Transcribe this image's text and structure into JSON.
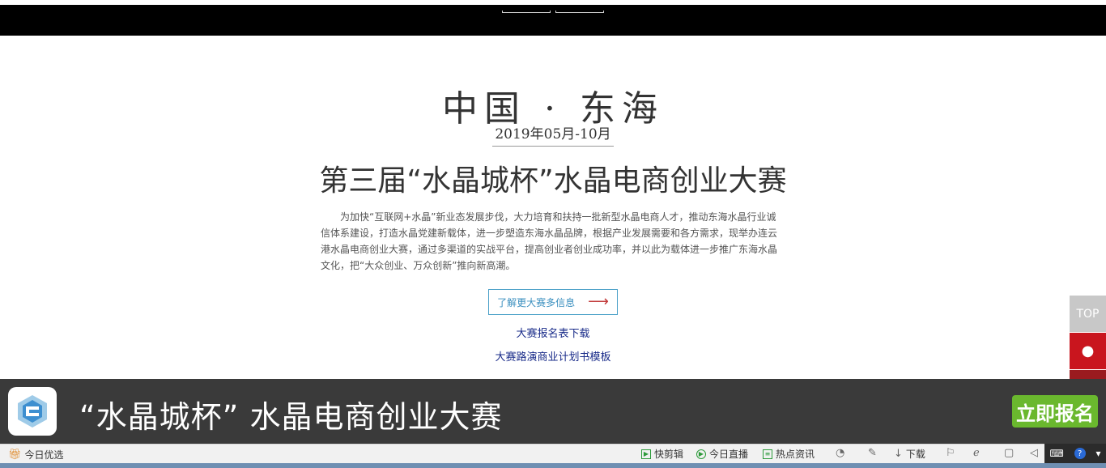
{
  "hero": {
    "headline": "中国 · 东海",
    "date": "2019年05月-10月",
    "title": "第三届“水晶城杯”水晶电商创业大赛",
    "intro": "为加快“互联网+水晶”新业态发展步伐，大力培育和扶持一批新型水晶电商人才，推动东海水晶行业诚信体系建设，打造水晶党建新载体，进一步塑造东海水晶品牌，根据产业发展需要和各方需求，现举办连云港水晶电商创业大赛，通过多渠道的实战平台，提高创业者创业成功率，并以此为载体进一步推广东海水晶文化，把“大众创业、万众创新”推向新高潮。",
    "learn_more": "了解更大赛多信息",
    "download_form": "大赛报名表下载",
    "download_template": "大赛路演商业计划书模板"
  },
  "side": {
    "top": "TOP"
  },
  "bottom_bar": {
    "title": "“水晶城杯”  水晶电商创业大赛",
    "signup": "立即报名"
  },
  "statusbar": {
    "today_pick": "今日优选",
    "quick_clip": "快剪辑",
    "live": "今日直播",
    "hot_news": "热点资讯",
    "download": "下载"
  },
  "colors": {
    "signup_green": "#6ab82e",
    "qq_red": "#c9151e",
    "link_blue": "#1a2c8a"
  }
}
